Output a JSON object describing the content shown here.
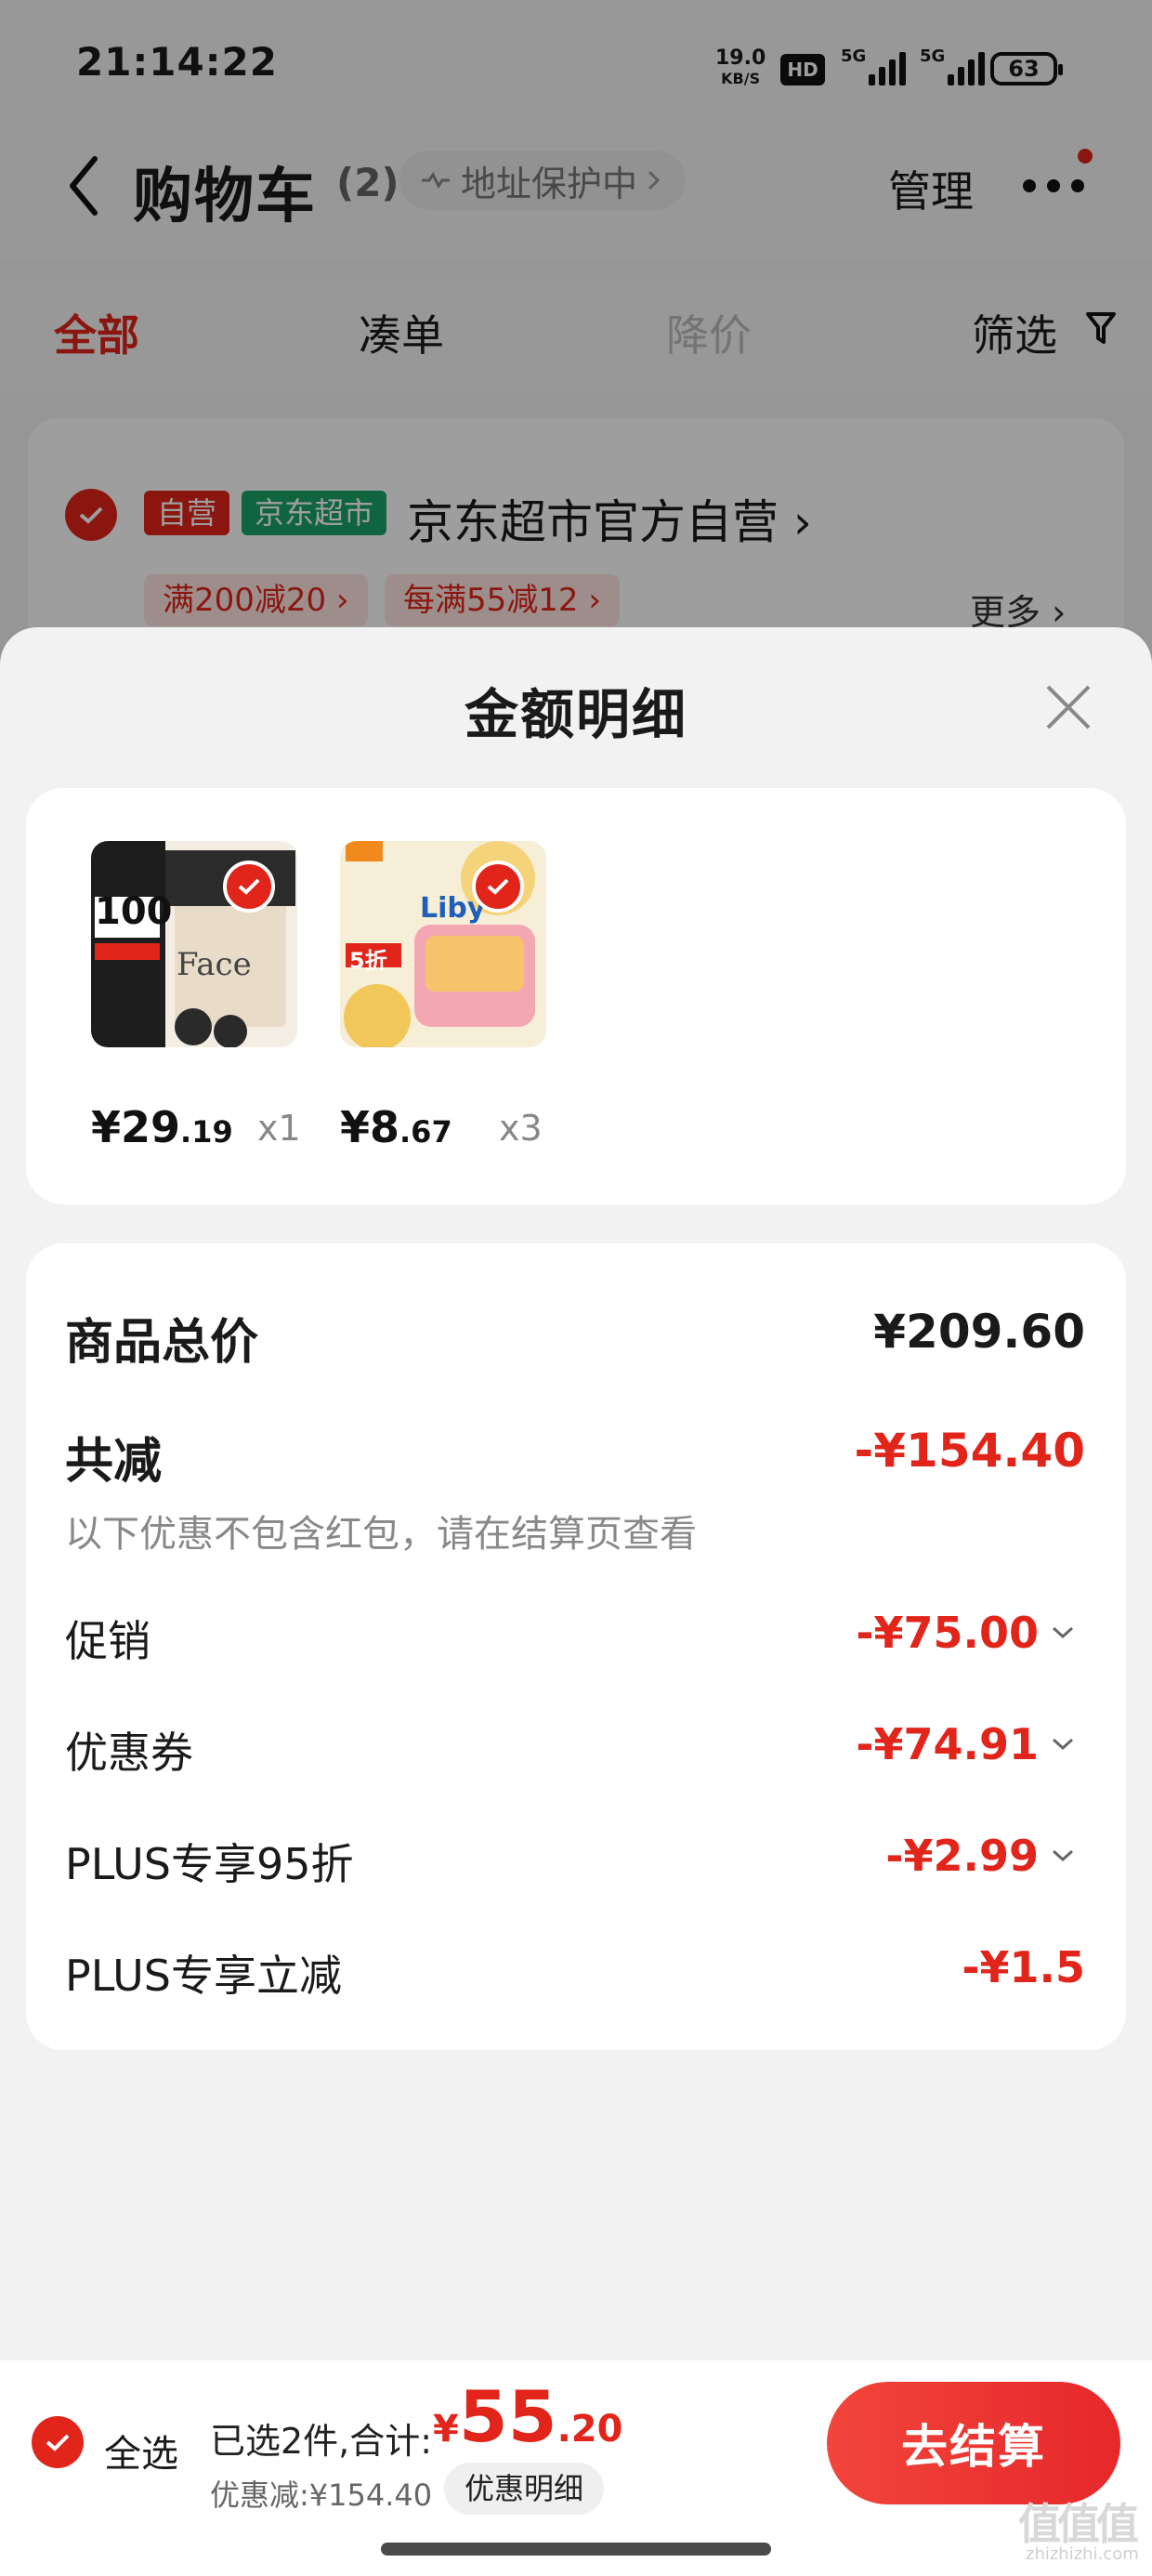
{
  "status_bar": {
    "time": "21:14:22",
    "net_speed_value": "19.0",
    "net_speed_unit": "KB/S",
    "hd_label": "HD",
    "signal1_label": "5G",
    "signal2_label": "5G",
    "battery": "63"
  },
  "header": {
    "title": "购物车",
    "count": "(2)",
    "address_pill": "地址保护中",
    "manage": "管理"
  },
  "tabs": [
    "全部",
    "凑单",
    "降价",
    "筛选"
  ],
  "store": {
    "tag_self": "自营",
    "tag_market": "京东超市",
    "name": "京东超市官方自营",
    "promos": [
      "满200减20",
      "每满55减12"
    ],
    "more": "更多"
  },
  "sheet": {
    "title": "金额明细",
    "products": [
      {
        "price_int": "¥29",
        "price_dec": ".19",
        "qty": "x1",
        "thumb_text": "Face",
        "thumb_badge": "100"
      },
      {
        "price_int": "¥8",
        "price_dec": ".67",
        "qty": "x3",
        "thumb_text": "Liby",
        "thumb_badge": "5折"
      }
    ],
    "summary": {
      "total_label": "商品总价",
      "total_value": "¥209.60",
      "reduce_label": "共减",
      "reduce_value": "-¥154.40",
      "note": "以下优惠不包含红包，请在结算页查看",
      "rows": [
        {
          "label": "促销",
          "value": "-¥75.00"
        },
        {
          "label": "优惠券",
          "value": "-¥74.91"
        },
        {
          "label": "PLUS专享95折",
          "value": "-¥2.99"
        },
        {
          "label": "PLUS专享立减",
          "value": "-¥1.5"
        }
      ]
    }
  },
  "bottom_bar": {
    "select_all": "全选",
    "selected_text": "已选2件,合计:",
    "total_currency": "¥",
    "total_int": "55",
    "total_dec": ".20",
    "discount_text": "优惠减:¥154.40",
    "detail_button": "优惠明细",
    "checkout": "去结算"
  },
  "watermark": {
    "main": "值值值",
    "sub": "zhizhizhi.com"
  },
  "colors": {
    "accent": "#e1251b",
    "green_tag": "#1aa268"
  }
}
